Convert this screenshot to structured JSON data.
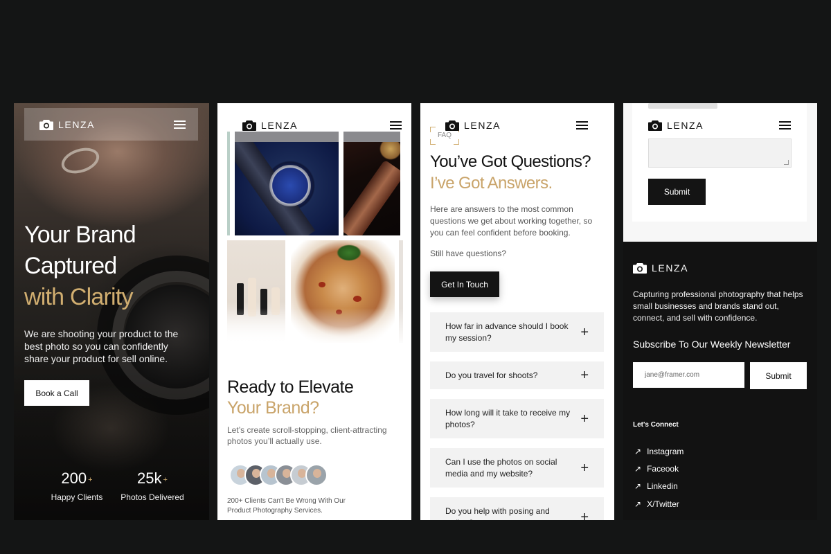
{
  "brand": "LENZA",
  "colors": {
    "background": "#141515",
    "accent_gold": "#d1ae70",
    "dark": "#141414",
    "light_panel": "#f2f2f2"
  },
  "screen1": {
    "title_line1": "Your Brand",
    "title_line2": "Captured",
    "title_line3": "with Clarity",
    "subtitle": "We are shooting your product to the best photo so you can confidently share your product for sell online.",
    "cta": "Book a Call",
    "stats": [
      {
        "value": "200",
        "suffix": "+",
        "label": "Happy Clients"
      },
      {
        "value": "25k",
        "suffix": "+",
        "label": "Photos Delivered"
      }
    ]
  },
  "screen2": {
    "title_line1": "Ready to Elevate",
    "title_line2": "Your Brand?",
    "description": "Let’s create scroll-stopping, client-attracting photos you’ll actually use.",
    "footnote": "200+ Clients Can't Be Wrong With Our Product Photography Services.",
    "avatar_count": 6
  },
  "screen3": {
    "tag": "FAQ",
    "title_line1": "You’ve Got Questions?",
    "title_line2": "I’ve Got Answers.",
    "description": "Here are answers to the most common questions we get about working together, so you can feel confident before booking.",
    "still": "Still have questions?",
    "cta": "Get In Touch",
    "faqs": [
      "How far in advance should I book my session?",
      "Do you travel for shoots?",
      "How long will it take to receive my photos?",
      "Can I use the photos on social media and my website?",
      "Do you help with posing and styling?"
    ],
    "plus_icon": "plus-icon"
  },
  "screen4": {
    "submit": "Submit",
    "description": "Capturing professional photography that helps small businesses and brands stand out, connect, and sell with confidence.",
    "newsletter": "Subscribe To Our Weekly Newsletter",
    "email_placeholder": "jane@framer.com",
    "newsletter_submit": "Submit",
    "connect": "Let's Connect",
    "links": [
      "Instagram",
      "Faceook",
      "Linkedin",
      "X/Twitter"
    ],
    "link_icon": "arrow-up-right-icon"
  }
}
